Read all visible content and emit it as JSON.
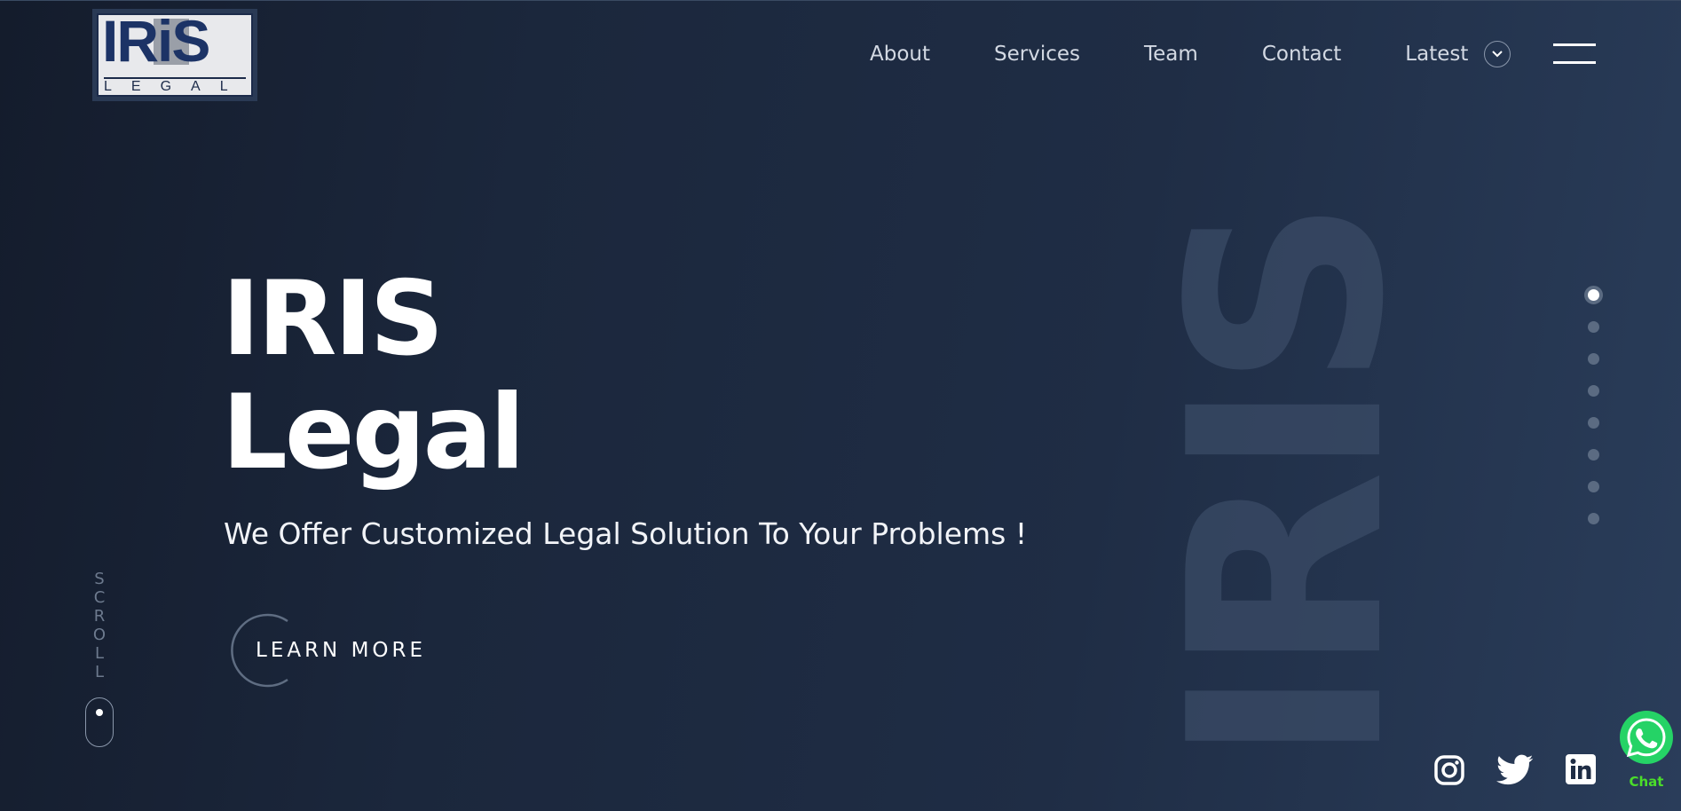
{
  "logo": {
    "word": "IRiS",
    "sub": "LEGAL"
  },
  "nav": {
    "items": [
      "About",
      "Services",
      "Team",
      "Contact"
    ],
    "latest": "Latest"
  },
  "hero": {
    "title_line1": "IRIS",
    "title_line2": "Legal",
    "subtitle": "We Offer Customized Legal Solution To Your Problems !",
    "cta": "LEARN MORE",
    "bg_text": "IRIS"
  },
  "scroll": {
    "letters": [
      "S",
      "C",
      "R",
      "O",
      "L",
      "L"
    ]
  },
  "pagination": {
    "total": 8,
    "active_index": 0
  },
  "social": {
    "icons": [
      "instagram-icon",
      "twitter-icon",
      "linkedin-icon"
    ],
    "chat_label": "Chat"
  },
  "colors": {
    "chat_green": "#4ade2a",
    "whatsapp_green": "#25d366",
    "logo_navy": "#1c3366"
  }
}
